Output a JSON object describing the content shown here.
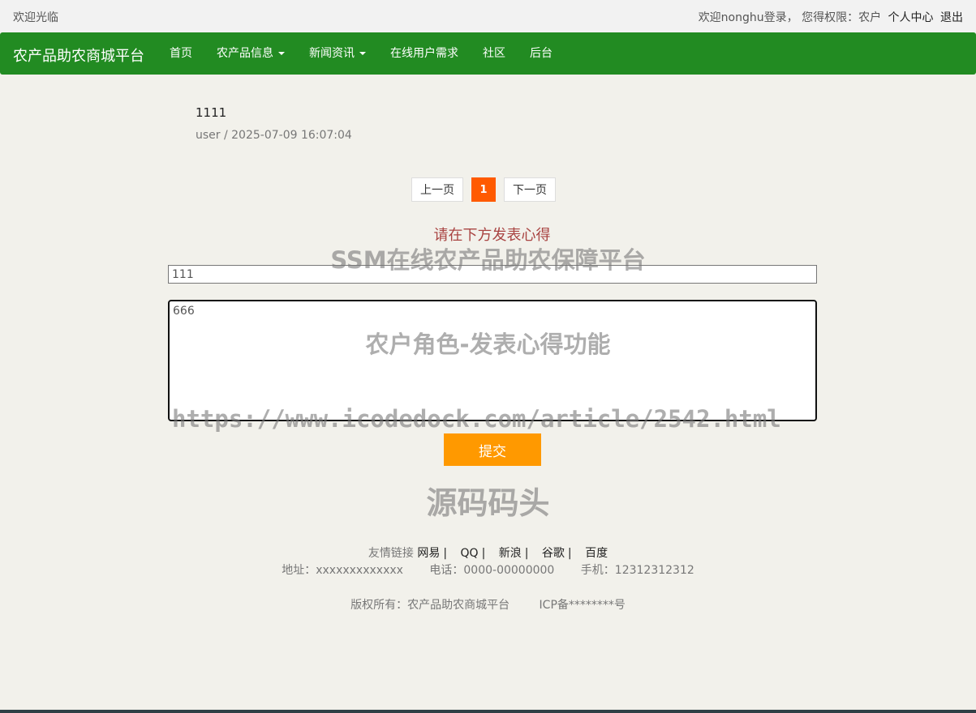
{
  "topbar": {
    "welcome": "欢迎光临",
    "user_info": "欢迎nonghu登录， 您得权限：农户",
    "profile_link": "个人中心",
    "logout_link": "退出"
  },
  "navbar": {
    "brand": "农产品助农商城平台",
    "items": [
      {
        "label": "首页"
      },
      {
        "label": "农产品信息"
      },
      {
        "label": "新闻资讯"
      },
      {
        "label": "在线用户需求"
      },
      {
        "label": "社区"
      },
      {
        "label": "后台"
      }
    ]
  },
  "post": {
    "title": "1111",
    "meta": "user / 2025-07-09 16:07:04"
  },
  "pagination": {
    "prev": "上一页",
    "current": "1",
    "next": "下一页"
  },
  "form": {
    "prompt": "请在下方发表心得",
    "title_value": "111",
    "content_value": "666",
    "submit": "提交"
  },
  "watermarks": {
    "line1": "SSM在线农产品助农保障平台",
    "line2": "农户角色-发表心得功能",
    "line3": "https://www.icodedock.com/article/2542.html",
    "line4": "源码码头"
  },
  "footer": {
    "links_label": "友情链接",
    "links": [
      {
        "label": "网易"
      },
      {
        "label": "QQ"
      },
      {
        "label": "新浪"
      },
      {
        "label": "谷歌"
      },
      {
        "label": "百度"
      }
    ],
    "address": "地址：xxxxxxxxxxxxx",
    "phone": "电话：0000-00000000",
    "mobile": "手机：12312312312",
    "copyright": "版权所有：农产品助农商城平台",
    "icp": "ICP备********号"
  },
  "colors": {
    "nav_bg": "#228b22",
    "page_bg": "#f2f1eb",
    "active_page": "#ff5a00",
    "submit_bg": "#ff9900",
    "prompt_text": "#a94442"
  }
}
